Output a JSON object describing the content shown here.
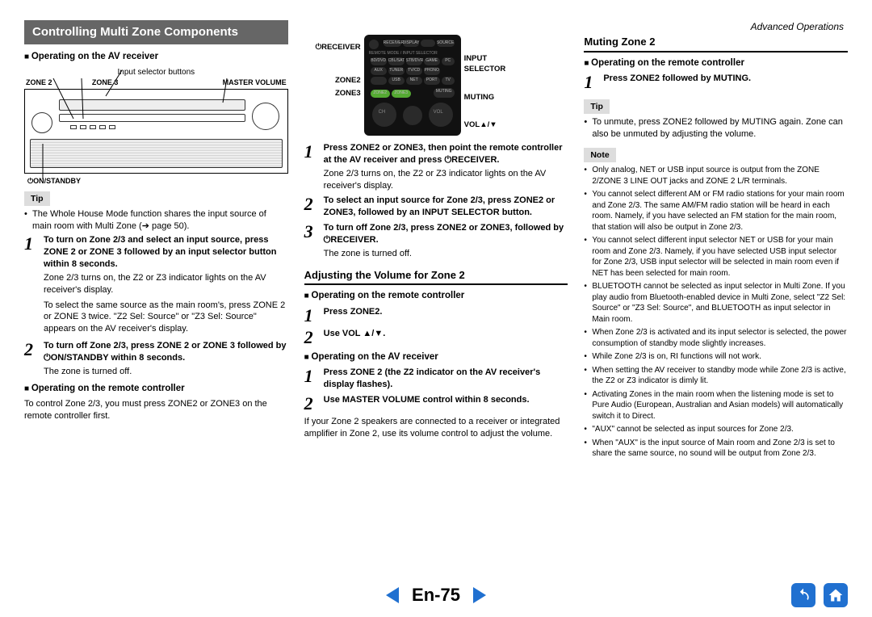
{
  "header": {
    "section": "Advanced Operations"
  },
  "title": "Controlling Multi Zone Components",
  "receiver_diagram": {
    "caption_top": "Input selector buttons",
    "labels": {
      "zone2": "ZONE 2",
      "zone3": "ZONE 3",
      "master_vol": "MASTER VOLUME",
      "standby": "⏻ON/STANDBY"
    }
  },
  "remote_diagram": {
    "left": {
      "receiver": "⏻RECEIVER",
      "zone2": "ZONE2",
      "zone3": "ZONE3"
    },
    "right": {
      "input": "INPUT\nSELECTOR",
      "muting": "MUTING",
      "vol": "VOL▲/▼"
    }
  },
  "col1": {
    "h_av": "Operating on the AV receiver",
    "tip_label": "Tip",
    "tip_items": [
      "The Whole House Mode function shares the input source of main room with Multi Zone (➔ page 50)."
    ],
    "steps_a": [
      {
        "n": "1",
        "bold": "To turn on Zone 2/3 and select an input source, press ZONE 2 or ZONE 3 followed by an input selector button within 8 seconds.",
        "desc": "Zone 2/3 turns on, the Z2 or Z3 indicator lights on the AV receiver's display."
      }
    ],
    "note_a": "To select the same source as the main room's, press ZONE 2 or ZONE 3 twice. \"Z2 Sel: Source\" or \"Z3 Sel: Source\" appears on the AV receiver's display.",
    "steps_b": [
      {
        "n": "2",
        "bold": "To turn off Zone 2/3, press ZONE 2 or ZONE 3 followed by ⏻ON/STANDBY within 8 seconds.",
        "desc": "The zone is turned off."
      }
    ],
    "h_remote": "Operating on the remote controller",
    "remote_text": "To control Zone 2/3, you must press ZONE2 or ZONE3 on the remote controller first."
  },
  "col2": {
    "steps_a": [
      {
        "n": "1",
        "bold": "Press ZONE2 or ZONE3, then point the remote controller at the AV receiver and press ⏻RECEIVER.",
        "desc": "Zone 2/3 turns on, the Z2 or Z3 indicator lights on the AV receiver's display."
      },
      {
        "n": "2",
        "bold": "To select an input source for Zone 2/3, press ZONE2 or ZONE3, followed by an INPUT SELECTOR button.",
        "desc": ""
      },
      {
        "n": "3",
        "bold": "To turn off Zone 2/3, press ZONE2 or ZONE3, followed by ⏻RECEIVER.",
        "desc": "The zone is turned off."
      }
    ],
    "h_adjust": "Adjusting the Volume for Zone 2",
    "h_remote": "Operating on the remote controller",
    "steps_b": [
      {
        "n": "1",
        "bold": "Press ZONE2.",
        "desc": ""
      },
      {
        "n": "2",
        "bold": "Use VOL ▲/▼.",
        "desc": ""
      }
    ],
    "h_av": "Operating on the AV receiver",
    "steps_c": [
      {
        "n": "1",
        "bold": "Press ZONE 2 (the Z2 indicator on the AV receiver's display flashes).",
        "desc": ""
      },
      {
        "n": "2",
        "bold": "Use MASTER VOLUME control within 8 seconds.",
        "desc": ""
      }
    ],
    "tail": "If your Zone 2 speakers are connected to a receiver or integrated amplifier in Zone 2, use its volume control to adjust the volume."
  },
  "col3": {
    "h_mute": "Muting Zone 2",
    "h_remote": "Operating on the remote controller",
    "steps_a": [
      {
        "n": "1",
        "bold": "Press ZONE2 followed by MUTING.",
        "desc": ""
      }
    ],
    "tip_label": "Tip",
    "tip_items": [
      "To unmute, press ZONE2 followed by MUTING again. Zone can also be unmuted by adjusting the volume."
    ],
    "note_label": "Note",
    "note_items": [
      "Only analog, NET or USB input source is output from the ZONE 2/ZONE 3 LINE OUT jacks and ZONE 2 L/R terminals.",
      "You cannot select different AM or FM radio stations for your main room and Zone 2/3. The same AM/FM radio station will be heard in each room. Namely, if you have selected an FM station for the main room, that station will also be output in Zone 2/3.",
      "You cannot select different input selector NET or USB for your main room and Zone 2/3. Namely, if you have selected USB input selector for Zone 2/3, USB input selector will be selected in main room even if NET has been selected for main room.",
      "BLUETOOTH cannot be selected as input selector in Multi Zone. If you play audio from Bluetooth-enabled device in Multi Zone, select \"Z2 Sel: Source\" or \"Z3 Sel: Source\", and BLUETOOTH as input selector in Main room.",
      "When Zone 2/3 is activated and its input selector is selected, the power consumption of standby mode slightly increases.",
      "While Zone 2/3 is on, RI functions will not work.",
      "When setting the AV receiver to standby mode while Zone 2/3 is active, the Z2 or Z3 indicator is dimly lit.",
      "Activating Zones in the main room when the listening mode is set to Pure Audio (European, Australian and Asian models) will automatically switch it to Direct.",
      "\"AUX\" cannot be selected as input sources for Zone 2/3.",
      "When \"AUX\" is the input source of Main room and Zone 2/3 is set to share the same source, no sound will be output from Zone 2/3."
    ]
  },
  "footer": {
    "page": "En-75"
  }
}
